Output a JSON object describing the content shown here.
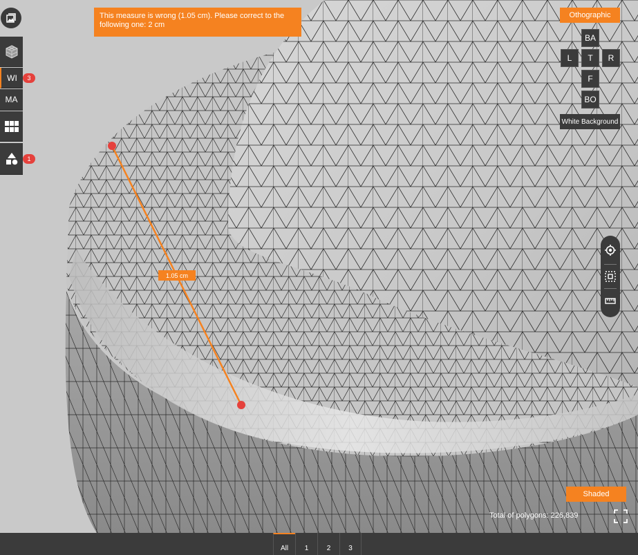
{
  "viewer": {
    "alert_message": "This measure is wrong (1.05 cm). Please correct to the following one: 2 cm",
    "measurement_label": "1.05 cm",
    "polygon_count_text": "Total of polygons: 226,839"
  },
  "left_toolbar": {
    "gallery_icon": "gallery-icon",
    "items": [
      {
        "label": "",
        "icon": "cube-mesh-icon"
      },
      {
        "label": "WI",
        "badge": "3"
      },
      {
        "label": "MA"
      },
      {
        "label": "",
        "icon": "grid-icon"
      },
      {
        "label": "",
        "icon": "shapes-icon",
        "badge": "1"
      }
    ]
  },
  "view_controls": {
    "projection_label": "Othographic",
    "views": {
      "back": "BA",
      "left": "L",
      "top": "T",
      "right": "R",
      "front": "F",
      "bottom": "BO"
    },
    "background_label": "White Background",
    "render_mode_label": "Shaded"
  },
  "right_tools": [
    "target-icon",
    "fit-selection-icon",
    "ruler-icon"
  ],
  "bottom_tabs": [
    "All",
    "1",
    "2",
    "3"
  ],
  "colors": {
    "accent": "#f58220",
    "toolbar": "#3b3b3b",
    "badge": "#e5413c",
    "measure_point": "#e5413c"
  }
}
